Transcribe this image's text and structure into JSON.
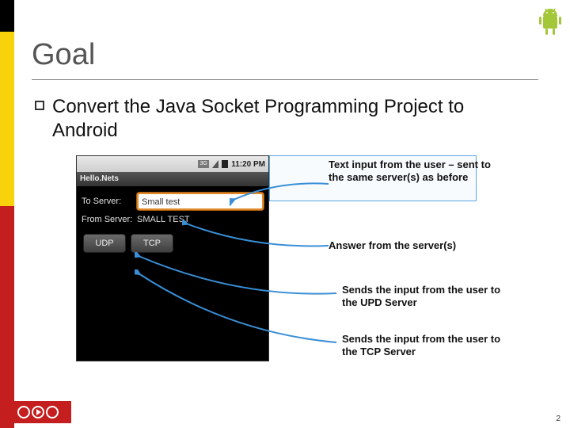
{
  "slide": {
    "title": "Goal",
    "bullet": "Convert the Java Socket Programming Project to Android",
    "page_number": "2"
  },
  "annotations": {
    "input": "Text input from the user – sent to the same server(s) as before",
    "answer": "Answer from the server(s)",
    "udp": "Sends the input from the user to the UPD Server",
    "tcp": "Sends the input from the user to the TCP Server"
  },
  "phone": {
    "status_time": "11:20 PM",
    "status_3g": "3G",
    "app_title": "Hello.Nets",
    "to_server_label": "To Server:",
    "to_server_value": "Small test",
    "from_server_label": "From Server:",
    "from_server_value": "SMALL TEST",
    "udp_button": "UDP",
    "tcp_button": "TCP"
  }
}
